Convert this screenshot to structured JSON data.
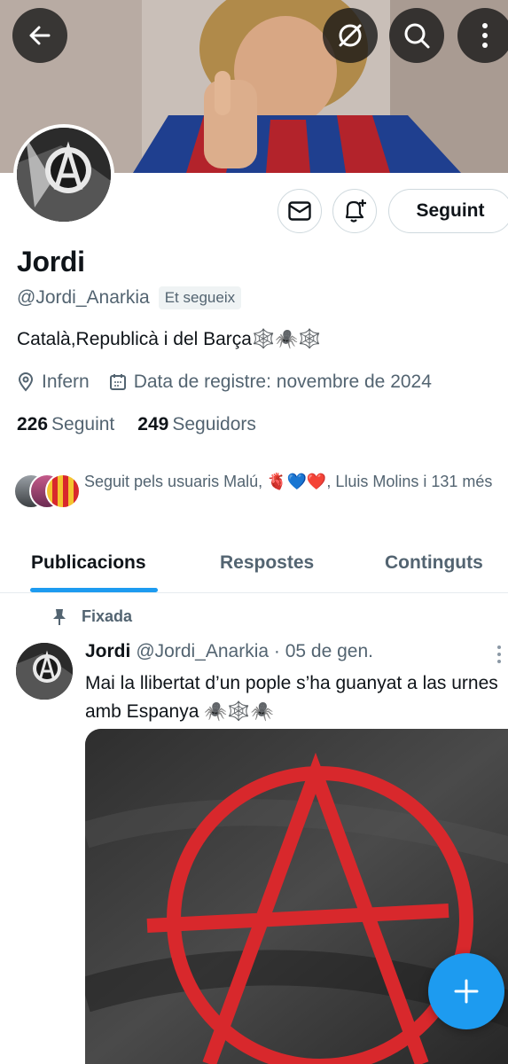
{
  "profile": {
    "name": "Jordi",
    "handle": "@Jordi_Anarkia",
    "follows_you_badge": "Et segueix",
    "bio": "Català,Republicà i del Barça🕸️🕷️🕸️",
    "location": "Infern",
    "joined": "Data de registre: novembre de 2024",
    "following_count": "226",
    "following_label": "Seguint",
    "followers_count": "249",
    "followers_label": "Seguidors",
    "followed_by": "Seguit pels usuaris Malú, 🫀💙❤️, Lluis Molins i 131 més",
    "follow_button": "Seguint"
  },
  "tabs": [
    {
      "label": "Publicacions",
      "active": true
    },
    {
      "label": "Respostes",
      "active": false
    },
    {
      "label": "Continguts",
      "active": false
    }
  ],
  "post": {
    "pinned_label": "Fixada",
    "author_name": "Jordi",
    "author_handle_time": "@Jordi_Anarkia · 05 de gen.",
    "text": "Mai la llibertat d’un pople s’ha guanyat a las urnes amb Espanya 🕷️🕸️🕷️"
  },
  "icons": {
    "back": "arrow-left-icon",
    "grok": "grok-icon",
    "search": "search-icon",
    "more": "more-vertical-icon",
    "message": "envelope-icon",
    "notify": "bell-plus-icon",
    "location": "location-pin-icon",
    "calendar": "calendar-icon",
    "pin": "pin-icon",
    "compose": "plus-icon"
  },
  "colors": {
    "accent": "#1d9bf0",
    "text_primary": "#0f1419",
    "text_secondary": "#536471",
    "anarchy_red": "#d8282c"
  }
}
